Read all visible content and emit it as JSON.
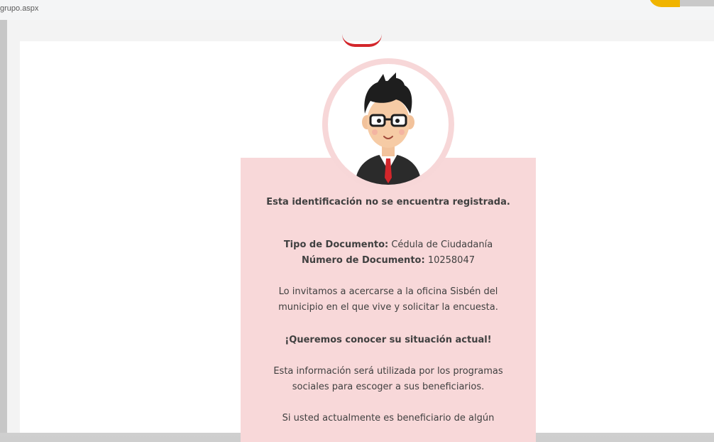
{
  "browser": {
    "url": "grupo.aspx"
  },
  "card": {
    "heading": "Esta identificación no se encuentra registrada.",
    "doc_type_label": "Tipo de Documento:",
    "doc_type_value": "Cédula de Ciudadanía",
    "doc_number_label": "Número de Documento:",
    "doc_number_value": "10258047",
    "invite_line1": "Lo invitamos a acercarse a la oficina Sisbén del",
    "invite_line2": "municipio en el que vive y solicitar la encuesta.",
    "call_to_action": "¡Queremos conocer su situación actual!",
    "info_line1": "Esta información será utilizada por los programas",
    "info_line2": "sociales para escoger a sus beneficiarios.",
    "beneficiary_line1": "Si usted actualmente es beneficiario de algún"
  },
  "colors": {
    "card_background": "#f8d8d9",
    "logo_red": "#d3262b"
  },
  "icons": {
    "avatar": "man-with-glasses-avatar"
  }
}
